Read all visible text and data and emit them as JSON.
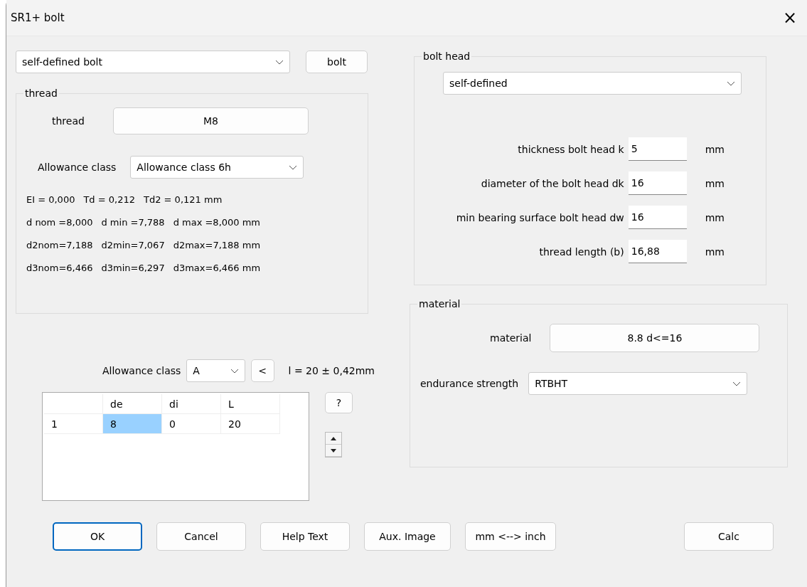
{
  "window": {
    "title": "SR1+  bolt",
    "close": "×"
  },
  "bolt_type": {
    "value": "self-defined bolt"
  },
  "bolt_button": "bolt",
  "thread": {
    "title": "thread",
    "label": "thread",
    "button": "M8",
    "allowance_label": "Allowance class",
    "allowance_value": "Allowance class 6h",
    "lines": [
      [
        "EI = 0,000",
        "Td = 0,212",
        "Td2 = 0,121 mm"
      ],
      [
        "d nom =8,000",
        "d min =7,788",
        "d max =8,000 mm"
      ],
      [
        "d2nom=7,188",
        "d2min=7,067",
        "d2max=7,188 mm"
      ],
      [
        "d3nom=6,466",
        "d3min=6,297",
        "d3max=6,466 mm"
      ]
    ]
  },
  "length": {
    "allowance_label": "Allowance class",
    "allowance_value": "A",
    "back_button": "<",
    "reading": "l = 20 ± 0,42mm",
    "help_button": "?"
  },
  "table": {
    "columns": [
      "",
      "de",
      "di",
      "L"
    ],
    "rows": [
      {
        "cells": [
          {
            "text": "1",
            "selected": false
          },
          {
            "text": "8",
            "selected": true
          },
          {
            "text": "0",
            "selected": false
          },
          {
            "text": "20",
            "selected": false
          }
        ]
      }
    ]
  },
  "bolt_head": {
    "title": "bolt head",
    "type": "self-defined",
    "fields": [
      {
        "label": "thickness bolt head k",
        "value": "5",
        "unit": "mm"
      },
      {
        "label": "diameter of the bolt head dk",
        "value": "16",
        "unit": "mm"
      },
      {
        "label": "min bearing surface bolt head dw",
        "value": "16",
        "unit": "mm"
      },
      {
        "label": "thread length (b)",
        "value": "16,88",
        "unit": "mm"
      }
    ]
  },
  "material": {
    "title": "material",
    "label": "material",
    "button": "8.8 d<=16",
    "endurance_label": "endurance strength",
    "endurance_value": "RTBHT"
  },
  "buttons": [
    {
      "label": "OK",
      "default": true
    },
    {
      "label": "Cancel",
      "default": false
    },
    {
      "label": "Help Text",
      "default": false
    },
    {
      "label": "Aux. Image",
      "default": false
    },
    {
      "label": "mm <--> inch",
      "default": false
    },
    {
      "label": "Calc",
      "default": false
    }
  ]
}
